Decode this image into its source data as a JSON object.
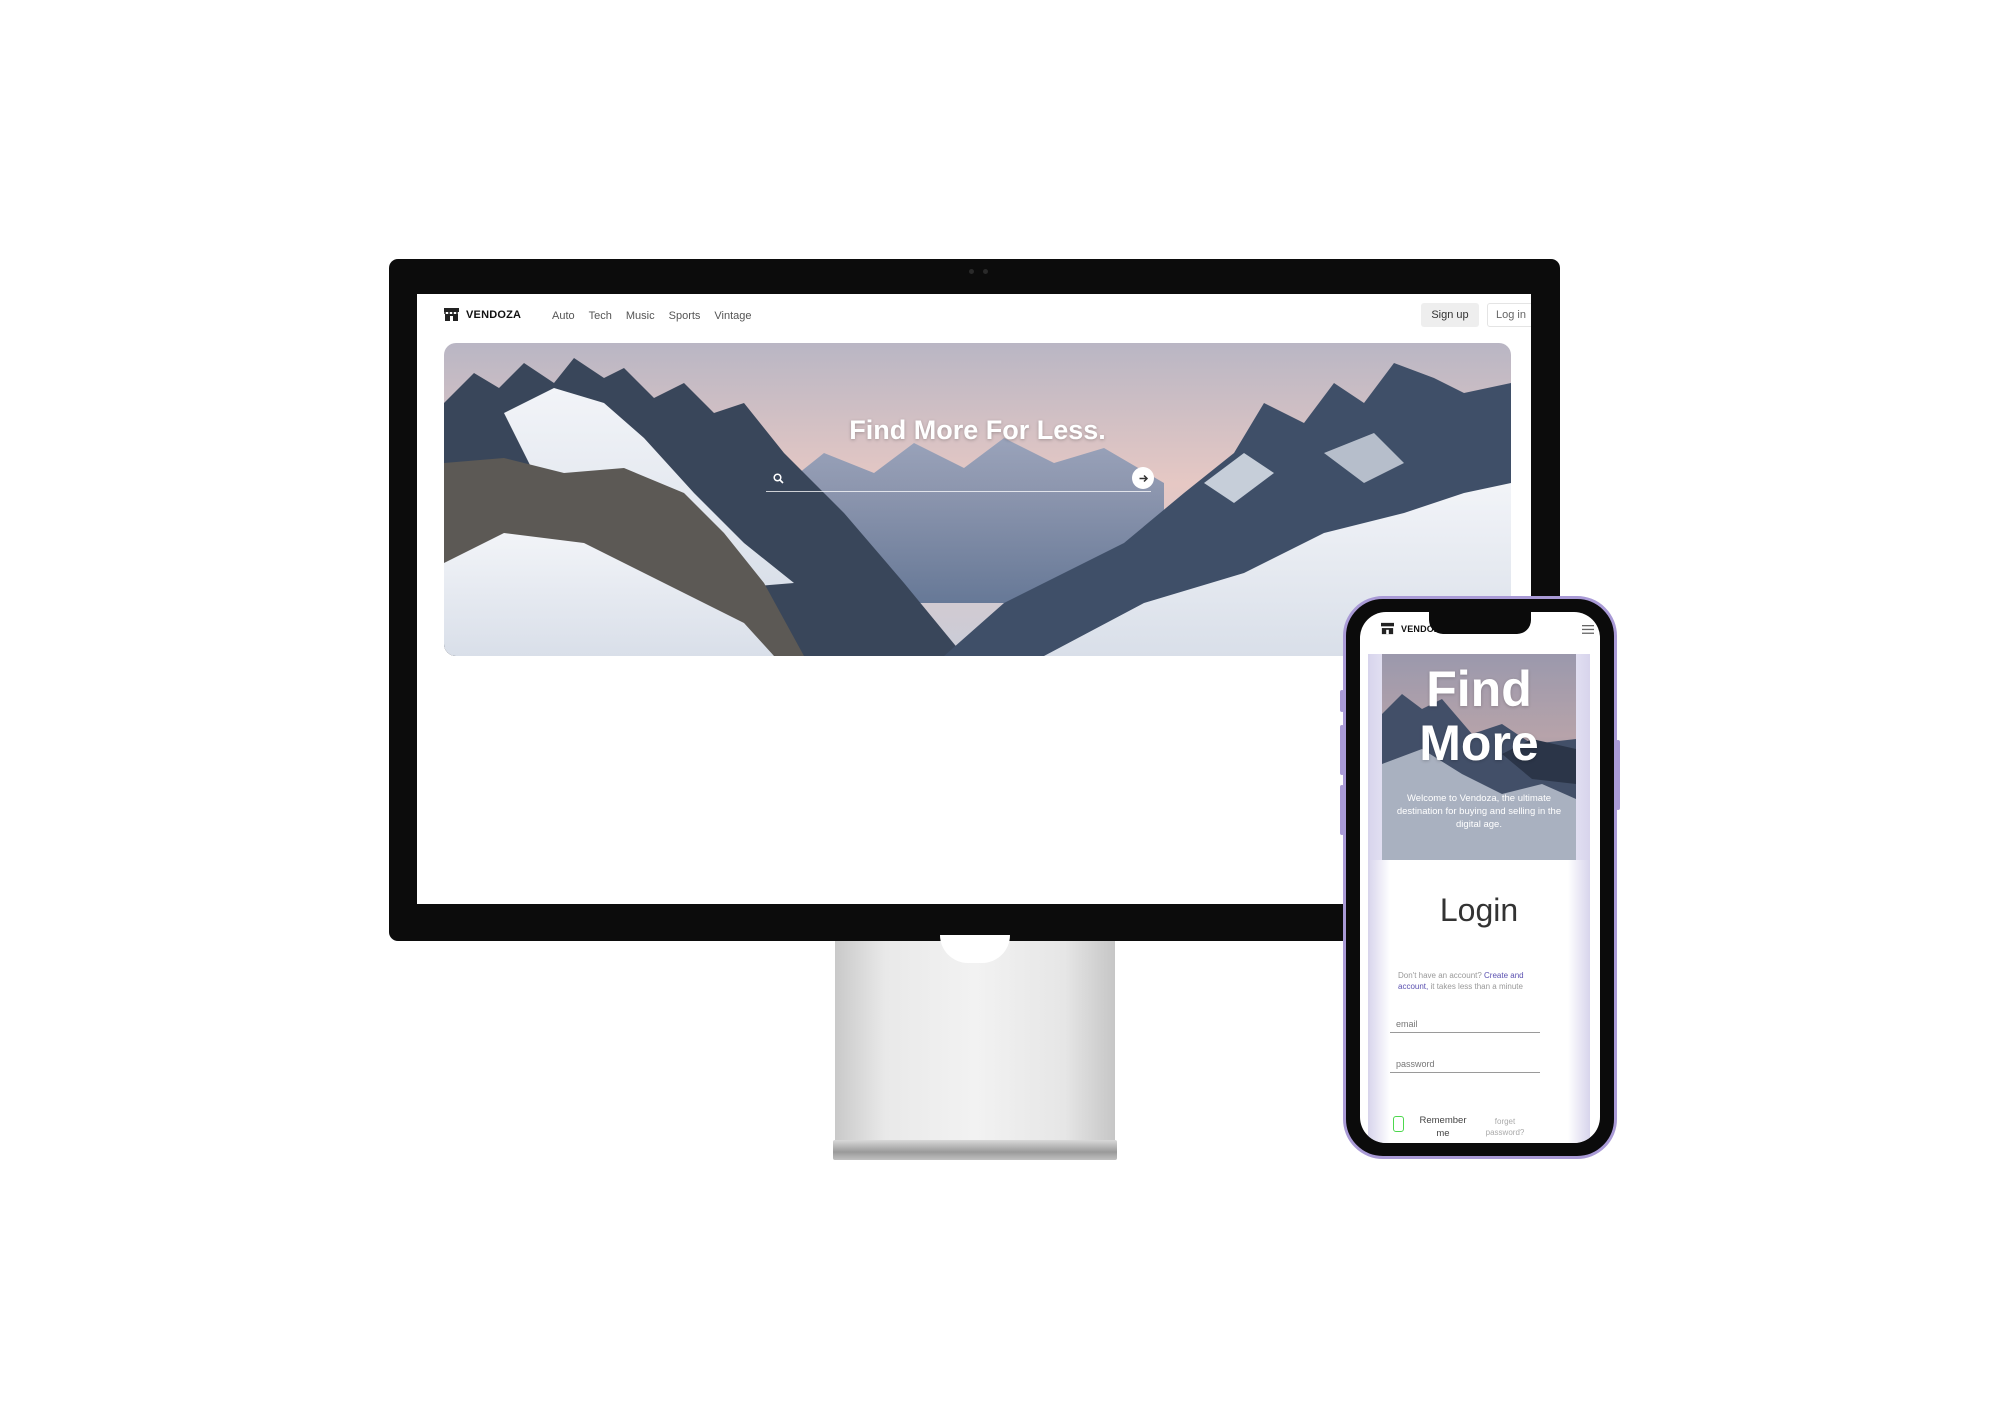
{
  "desktop": {
    "brand": "VENDOZA",
    "nav": [
      "Auto",
      "Tech",
      "Music",
      "Sports",
      "Vintage"
    ],
    "signup_label": "Sign up",
    "login_label": "Log in",
    "hero_title": "Find More For Less.",
    "search_placeholder": ""
  },
  "mobile": {
    "brand": "VENDOZA",
    "hero_title": "Find More",
    "hero_text": "Welcome to Vendoza, the ultimate destination for buying and selling in the digital age.",
    "login_title": "Login",
    "note_prefix": "Don't have an account? ",
    "note_link": "Create and account,",
    "note_suffix": " it takes less than a minute",
    "email_placeholder": "email",
    "password_placeholder": "password",
    "remember_label": "Remember me",
    "forgot_label": "forget password?"
  },
  "colors": {
    "accent": "#5b51b0",
    "phone_frame": "#a99ad6",
    "checkbox": "#4dd84d"
  }
}
